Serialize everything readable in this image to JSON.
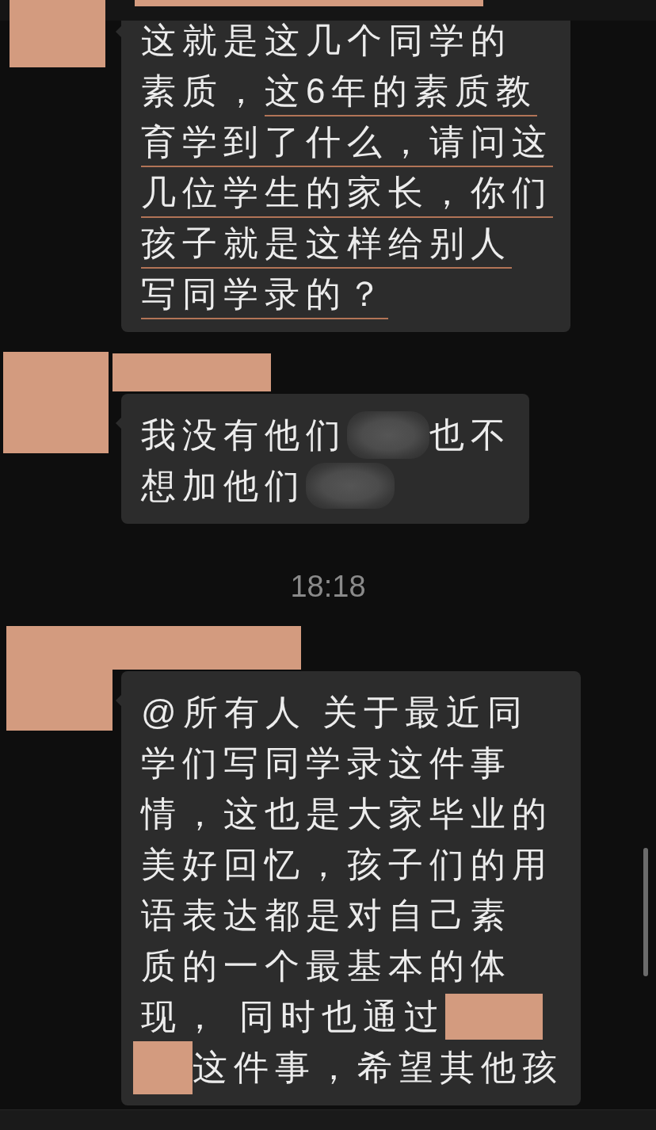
{
  "top_bar": {
    "redacted": true
  },
  "chat": [
    {
      "kind": "message",
      "avatar_redacted": true,
      "lines": [
        {
          "segments": [
            {
              "kind": "text",
              "text": "这就是这几个同学的",
              "underlined": false
            }
          ]
        },
        {
          "segments": [
            {
              "kind": "text",
              "text": "素质，",
              "underlined": false
            },
            {
              "kind": "text",
              "text": "这6年的素质教",
              "underlined": true
            }
          ]
        },
        {
          "segments": [
            {
              "kind": "text",
              "text": "育学到了什么，请问这",
              "underlined": true
            }
          ]
        },
        {
          "segments": [
            {
              "kind": "text",
              "text": "几位学生的家长，你们",
              "underlined": true
            }
          ]
        },
        {
          "segments": [
            {
              "kind": "text",
              "text": "孩子就是这样给别人",
              "underlined": true
            }
          ]
        },
        {
          "segments": [
            {
              "kind": "text",
              "text": "写同学录的？",
              "underlined": true
            }
          ]
        }
      ]
    },
    {
      "kind": "message",
      "avatar_redacted": true,
      "name_redacted": true,
      "lines": [
        {
          "segments": [
            {
              "kind": "text",
              "text": "我没有他们"
            },
            {
              "kind": "blur"
            },
            {
              "kind": "text",
              "text": "也不"
            }
          ]
        },
        {
          "segments": [
            {
              "kind": "text",
              "text": "想加他们"
            },
            {
              "kind": "blur"
            }
          ]
        }
      ]
    },
    {
      "kind": "time",
      "text": "18:18"
    },
    {
      "kind": "message",
      "avatar_redacted": true,
      "name_redacted": true,
      "lines": [
        {
          "segments": [
            {
              "kind": "text",
              "text": "@所有人 关于最近同"
            }
          ]
        },
        {
          "segments": [
            {
              "kind": "text",
              "text": "学们写同学录这件事"
            }
          ]
        },
        {
          "segments": [
            {
              "kind": "text",
              "text": "情，这也是大家毕业的"
            }
          ]
        },
        {
          "segments": [
            {
              "kind": "text",
              "text": "美好回忆，孩子们的用"
            }
          ]
        },
        {
          "segments": [
            {
              "kind": "text",
              "text": "语表达都是对自己素"
            }
          ]
        },
        {
          "segments": [
            {
              "kind": "text",
              "text": "质的一个最基本的体"
            }
          ]
        },
        {
          "segments": [
            {
              "kind": "text",
              "text": "现， 同时也通过"
            },
            {
              "kind": "redaction"
            }
          ]
        },
        {
          "segments": [
            {
              "kind": "redaction"
            },
            {
              "kind": "text",
              "text": "这件事，希望其他孩"
            }
          ]
        }
      ]
    }
  ]
}
